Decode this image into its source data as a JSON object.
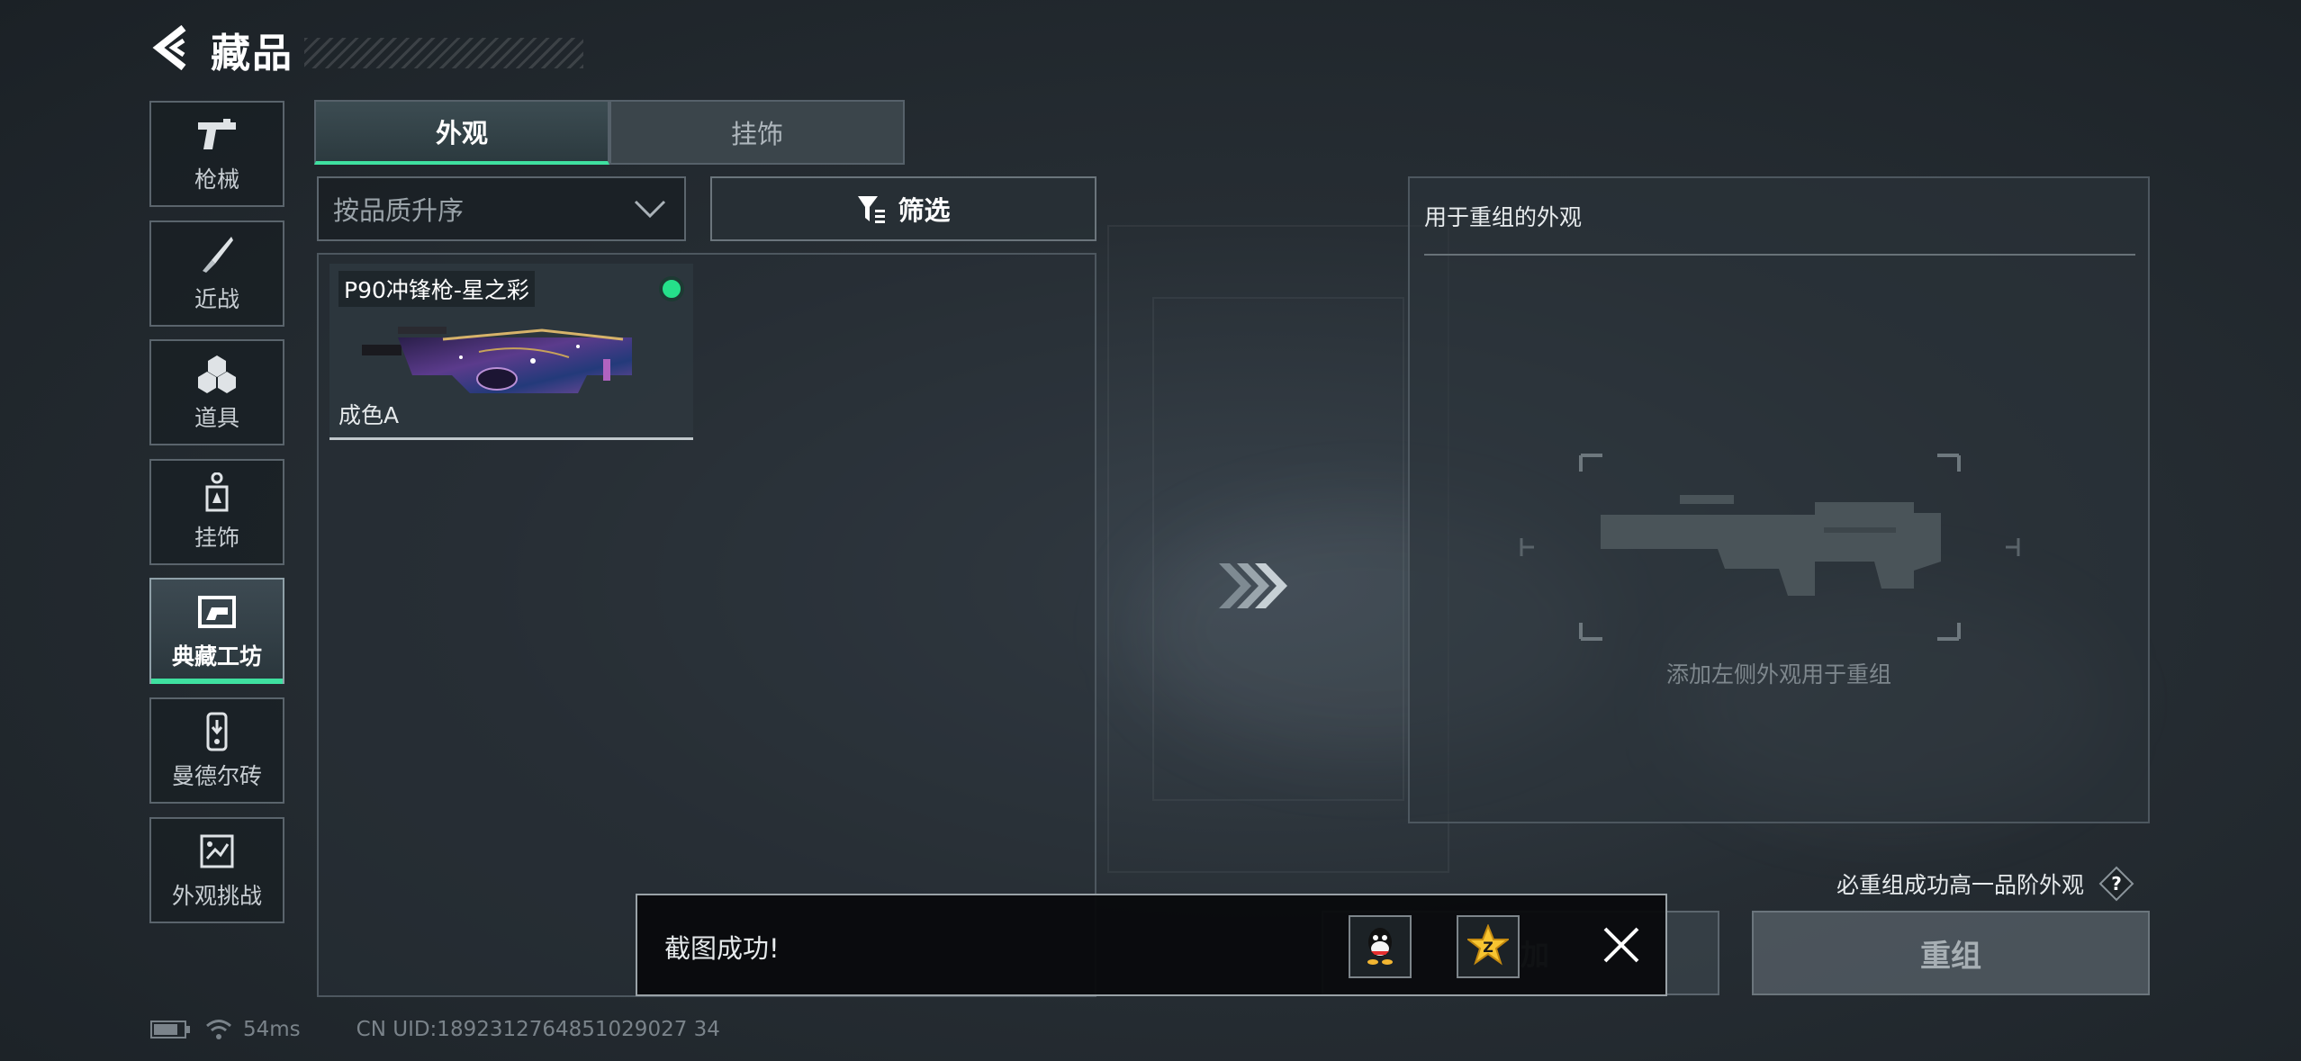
{
  "header": {
    "title": "藏品",
    "back_icon": "back-arrow-icon"
  },
  "sidebar": {
    "items": [
      {
        "label": "枪械",
        "icon": "pistol-icon",
        "active": false
      },
      {
        "label": "近战",
        "icon": "knife-icon",
        "active": false
      },
      {
        "label": "道具",
        "icon": "grenade-icon",
        "active": false
      },
      {
        "label": "挂饰",
        "icon": "charm-icon",
        "active": false
      },
      {
        "label": "典藏工坊",
        "icon": "workshop-icon",
        "active": true
      },
      {
        "label": "曼德尔砖",
        "icon": "brick-icon",
        "active": false
      },
      {
        "label": "外观挑战",
        "icon": "challenge-icon",
        "active": false
      }
    ]
  },
  "tabs": [
    {
      "label": "外观",
      "active": true
    },
    {
      "label": "挂饰",
      "active": false
    }
  ],
  "sort": {
    "value": "按品质升序"
  },
  "filter": {
    "label": "筛选"
  },
  "items": [
    {
      "name": "P90冲锋枪-星之彩",
      "grade": "成色A",
      "selected_indicator": "green-dot"
    }
  ],
  "recompose": {
    "title": "用于重组的外观",
    "hint": "添加左侧外观用于重组",
    "guarantee": "必重组成功高一品阶外观",
    "help_label": "?",
    "add_label": "添加",
    "button_label": "重组"
  },
  "toast": {
    "message": "截图成功!",
    "share_qq_icon": "qq-icon",
    "share_qzone_icon": "qzone-icon",
    "share_qzone_label": "Z"
  },
  "status": {
    "ping": "54ms",
    "uid": "CN UID:1892312764851029027 34"
  },
  "colors": {
    "accent": "#3fe0a0",
    "indicator": "#25e08a"
  }
}
